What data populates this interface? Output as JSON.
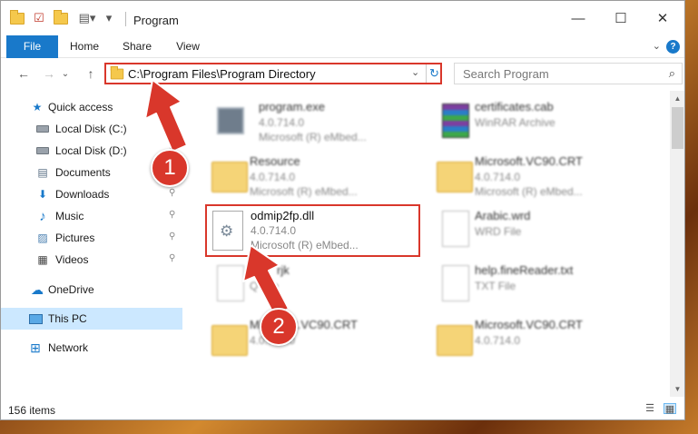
{
  "titlebar": {
    "title": "Program",
    "quick_access_icons": [
      "folder-icon",
      "properties-checkmark-icon",
      "new-folder-icon",
      "customize-toolbar-icon"
    ],
    "minimize": "—",
    "maximize": "☐",
    "close": "✕"
  },
  "ribbon": {
    "tabs": [
      "File",
      "Home",
      "Share",
      "View"
    ],
    "expand_glyph": "⌄",
    "help_glyph": "?"
  },
  "nav": {
    "back": "←",
    "forward": "→",
    "recent": "⌄",
    "up": "↑",
    "address": "C:\\Program Files\\Program Directory",
    "address_dropdown": "⌄",
    "refresh": "↻",
    "search_placeholder": "Search Program",
    "search_glyph": "⌕"
  },
  "sidebar": {
    "items": [
      {
        "label": "Quick access",
        "icon": "star-icon",
        "glyph": "★",
        "color": "#1979ca",
        "pinned": false
      },
      {
        "label": "Local Disk (C:)",
        "icon": "drive-icon",
        "glyph": "",
        "color": "#6e767e",
        "pinned": true
      },
      {
        "label": "Local Disk (D:)",
        "icon": "drive-icon",
        "glyph": "",
        "color": "#6e767e",
        "pinned": true
      },
      {
        "label": "Documents",
        "icon": "documents-icon",
        "glyph": "▤",
        "color": "#5a6f85",
        "pinned": true
      },
      {
        "label": "Downloads",
        "icon": "downloads-icon",
        "glyph": "⬇",
        "color": "#1979ca",
        "pinned": true
      },
      {
        "label": "Music",
        "icon": "music-icon",
        "glyph": "♪",
        "color": "#1979ca",
        "pinned": true
      },
      {
        "label": "Pictures",
        "icon": "pictures-icon",
        "glyph": "▨",
        "color": "#4a7fb0",
        "pinned": true
      },
      {
        "label": "Videos",
        "icon": "videos-icon",
        "glyph": "▦",
        "color": "#444",
        "pinned": true
      },
      {
        "label": "OneDrive",
        "icon": "cloud-icon",
        "glyph": "☁",
        "color": "#1979ca",
        "pinned": false
      },
      {
        "label": "This PC",
        "icon": "computer-icon",
        "glyph": "",
        "color": "#2c6ea8",
        "pinned": false,
        "selected": true
      },
      {
        "label": "Network",
        "icon": "network-icon",
        "glyph": "⊞",
        "color": "#1979ca",
        "pinned": false
      }
    ],
    "pin_glyph": "📌"
  },
  "files": [
    {
      "name": "program.exe",
      "meta1": "4.0.714.0",
      "meta2": "Microsoft (R) eMbed...",
      "icon": "exe"
    },
    {
      "name": "certificates.cab",
      "meta1": "WinRAR Archive",
      "meta2": "",
      "icon": "rar"
    },
    {
      "name": "Resource",
      "meta1": "4.0.714.0",
      "meta2": "Microsoft (R) eMbed...",
      "icon": "folder"
    },
    {
      "name": "Microsoft.VC90.CRT",
      "meta1": "4.0.714.0",
      "meta2": "Microsoft (R) eMbed...",
      "icon": "folder"
    },
    {
      "name": "odmip2fp.dll",
      "meta1": "4.0.714.0",
      "meta2": "Microsoft (R) eMbed...",
      "icon": "dll"
    },
    {
      "name": "Arabic.wrd",
      "meta1": "WRD File",
      "meta2": "",
      "icon": "doc"
    },
    {
      "name": "rjk",
      "meta1": "Q File",
      "meta2": "",
      "icon": "doc"
    },
    {
      "name": "help.fineReader.txt",
      "meta1": "TXT File",
      "meta2": "",
      "icon": "doc"
    },
    {
      "name": "Microsoft.VC90.CRT",
      "meta1": "4.0.714.0",
      "meta2": "",
      "icon": "folder"
    },
    {
      "name": "Microsoft.VC90.CRT",
      "meta1": "4.0.714.0",
      "meta2": "",
      "icon": "folder"
    }
  ],
  "status": {
    "items": "156 items"
  },
  "annotations": {
    "badge1": "1",
    "badge2": "2",
    "color": "#d9372b"
  }
}
